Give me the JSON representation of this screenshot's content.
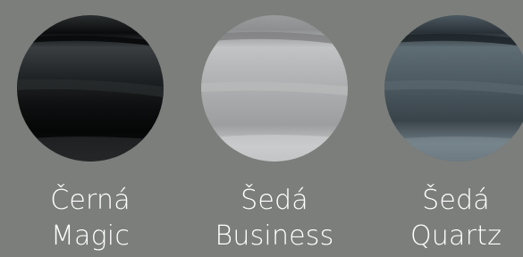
{
  "colors": [
    {
      "line1": "Černá",
      "line2": "Magic",
      "swatch": "#1a1c1d"
    },
    {
      "line1": "Šedá",
      "line2": "Business",
      "swatch": "#a8a8a8"
    },
    {
      "line1": "Šedá",
      "line2": "Quartz",
      "swatch": "#45525a"
    }
  ],
  "background": "#7b7e7b"
}
